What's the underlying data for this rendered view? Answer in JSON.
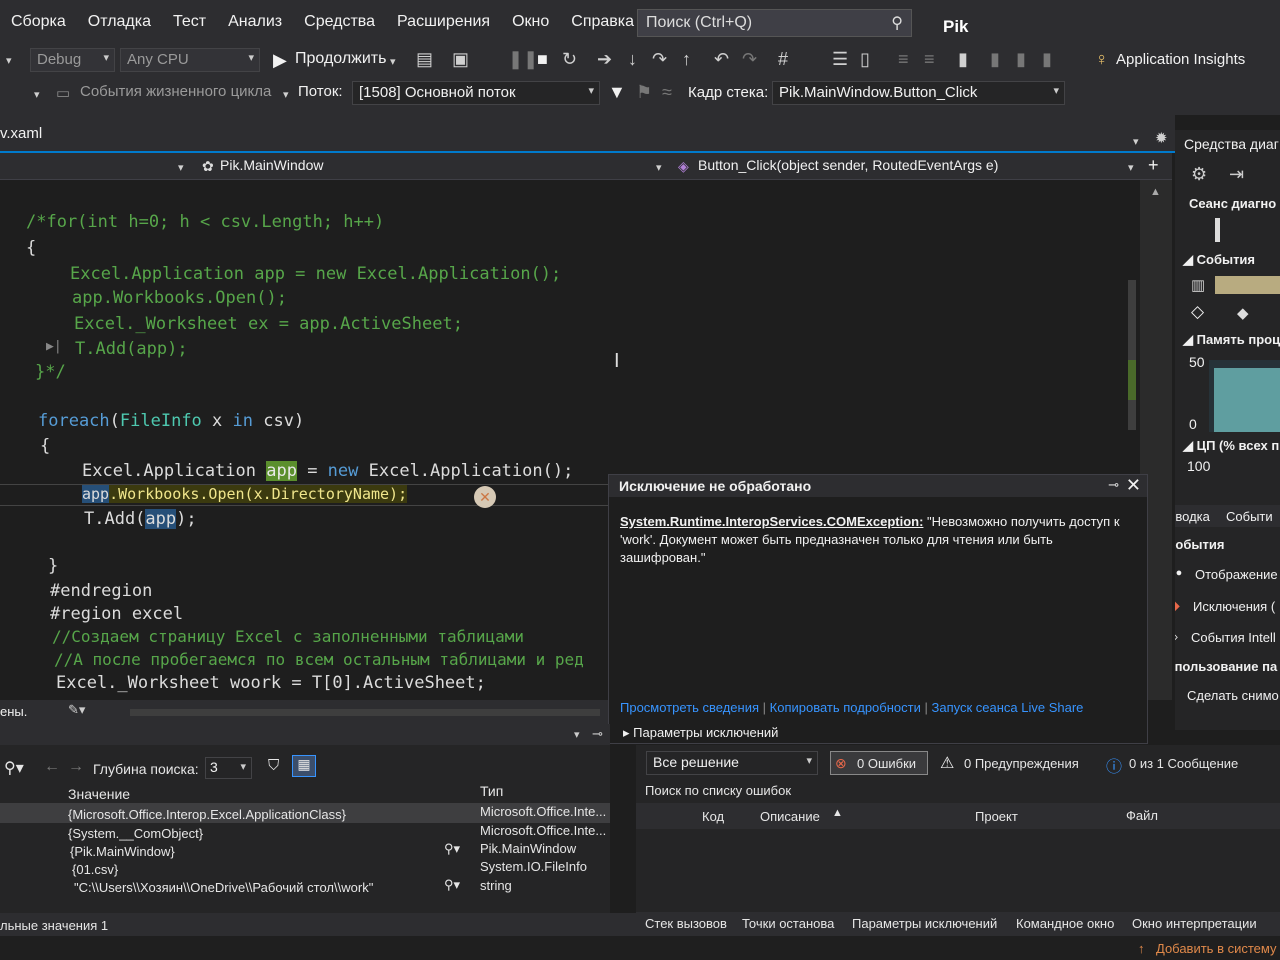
{
  "menu": [
    "Сборка",
    "Отладка",
    "Тест",
    "Анализ",
    "Средства",
    "Расширения",
    "Окно",
    "Справка"
  ],
  "search": {
    "placeholder": "Поиск (Ctrl+Q)"
  },
  "app_name": "Pik",
  "toolbar1": {
    "config": "Debug",
    "platform": "Any CPU",
    "continue": "Продолжить",
    "insights": "Application Insights"
  },
  "toolbar2": {
    "lifecycle": "События жизненного цикла",
    "thread_label": "Поток:",
    "thread_value": "[1508] Основной поток",
    "stack_label": "Кадр стека:",
    "stack_value": "Pik.MainWindow.Button_Click"
  },
  "tab": {
    "file": "v.xaml"
  },
  "navbar": {
    "class": "Pik.MainWindow",
    "member": "Button_Click(object sender, RoutedEventArgs e)"
  },
  "code": {
    "l1": "/*for(int h=0; h < csv.Length; h++)",
    "l2": "{",
    "l3": "Excel.Application app = new Excel.Application();",
    "l4": "app.Workbooks.Open();",
    "l5": "Excel._Worksheet ex = app.ActiveSheet;",
    "l6": "T.Add(app);",
    "l7": "}*/",
    "l8_kw": "foreach",
    "l8_a": "(",
    "l8_ty": "FileInfo",
    "l8_b": " x ",
    "l8_in": "in",
    "l8_c": " csv)",
    "l9": "{",
    "l10_a": "Excel.Application ",
    "l10_app": "app",
    "l10_b": " = ",
    "l10_new": "new",
    "l10_c": " Excel.Application();",
    "l11_app": "app",
    "l11_rest": ".Workbooks.Open(x.DirectoryName);",
    "l12_a": "T.Add(",
    "l12_app": "app",
    "l12_b": ");",
    "l13": "}",
    "l14": "#endregion",
    "l15": "#region excel",
    "l16": "//Создаем страницу Excel с заполненными таблицами",
    "l17": "//А после пробегаемся по всем остальным таблицами и ред",
    "l18": "Excel._Worksheet woork = T[0].ActiveSheet;"
  },
  "exception": {
    "title": "Исключение не обработано",
    "type": "System.Runtime.InteropServices.COMException:",
    "message": "\"Невозможно получить доступ к 'work'. Документ может быть предназначен только для чтения или быть зашифрован.\"",
    "link_details": "Просмотреть сведения",
    "link_copy": "Копировать подробности",
    "link_share": "Запуск сеанса Live Share",
    "settings": "Параметры исключений"
  },
  "diag": {
    "title": "Средства диаг",
    "session": "Сеанс диагно",
    "events": "События",
    "memory": "Память проце",
    "mem_max": "50",
    "mem_min": "0",
    "cpu": "ЦП (% всех пр",
    "cpu_max": "100",
    "tab_summary": "Сводка",
    "tab_events": "Событи",
    "events_header": "События",
    "ev1": "Отображение",
    "ev2": "Исключения (",
    "ev3": "События Intell",
    "usage": "Использование па",
    "snapshot": "Сделать снимо"
  },
  "editor_footer": "ены.",
  "autos": {
    "depth_label": "Глубина поиска:",
    "depth_value": "3",
    "col_value": "Значение",
    "col_type": "Тип",
    "rows": [
      {
        "value": "{Microsoft.Office.Interop.Excel.ApplicationClass}",
        "type": "Microsoft.Office.Inte..."
      },
      {
        "value": "{System.__ComObject}",
        "type": "Microsoft.Office.Inte..."
      },
      {
        "value": "{Pik.MainWindow}",
        "type": "Pik.MainWindow"
      },
      {
        "value": "{01.csv}",
        "type": "System.IO.FileInfo"
      },
      {
        "value": "\"C:\\\\Users\\\\Хозяин\\\\OneDrive\\\\Рабочий стол\\\\work\"",
        "type": "string"
      }
    ],
    "tab": "льные значения 1"
  },
  "errors": {
    "scope": "Все решение",
    "errors": "0 Ошибки",
    "warnings": "0 Предупреждения",
    "messages": "0 из 1 Сообщение",
    "search": "Поиск по списку ошибок",
    "col_code": "Код",
    "col_desc": "Описание",
    "col_project": "Проект",
    "col_file": "Файл"
  },
  "bottom_tabs": [
    "Стек вызовов",
    "Точки останова",
    "Параметры исключений",
    "Командное окно",
    "Окно интерпретации"
  ],
  "status": {
    "add": "Добавить в систему"
  },
  "colors": {
    "accent": "#007acc",
    "link": "#3794ff",
    "breakpoint_line": "#f0e68c"
  }
}
